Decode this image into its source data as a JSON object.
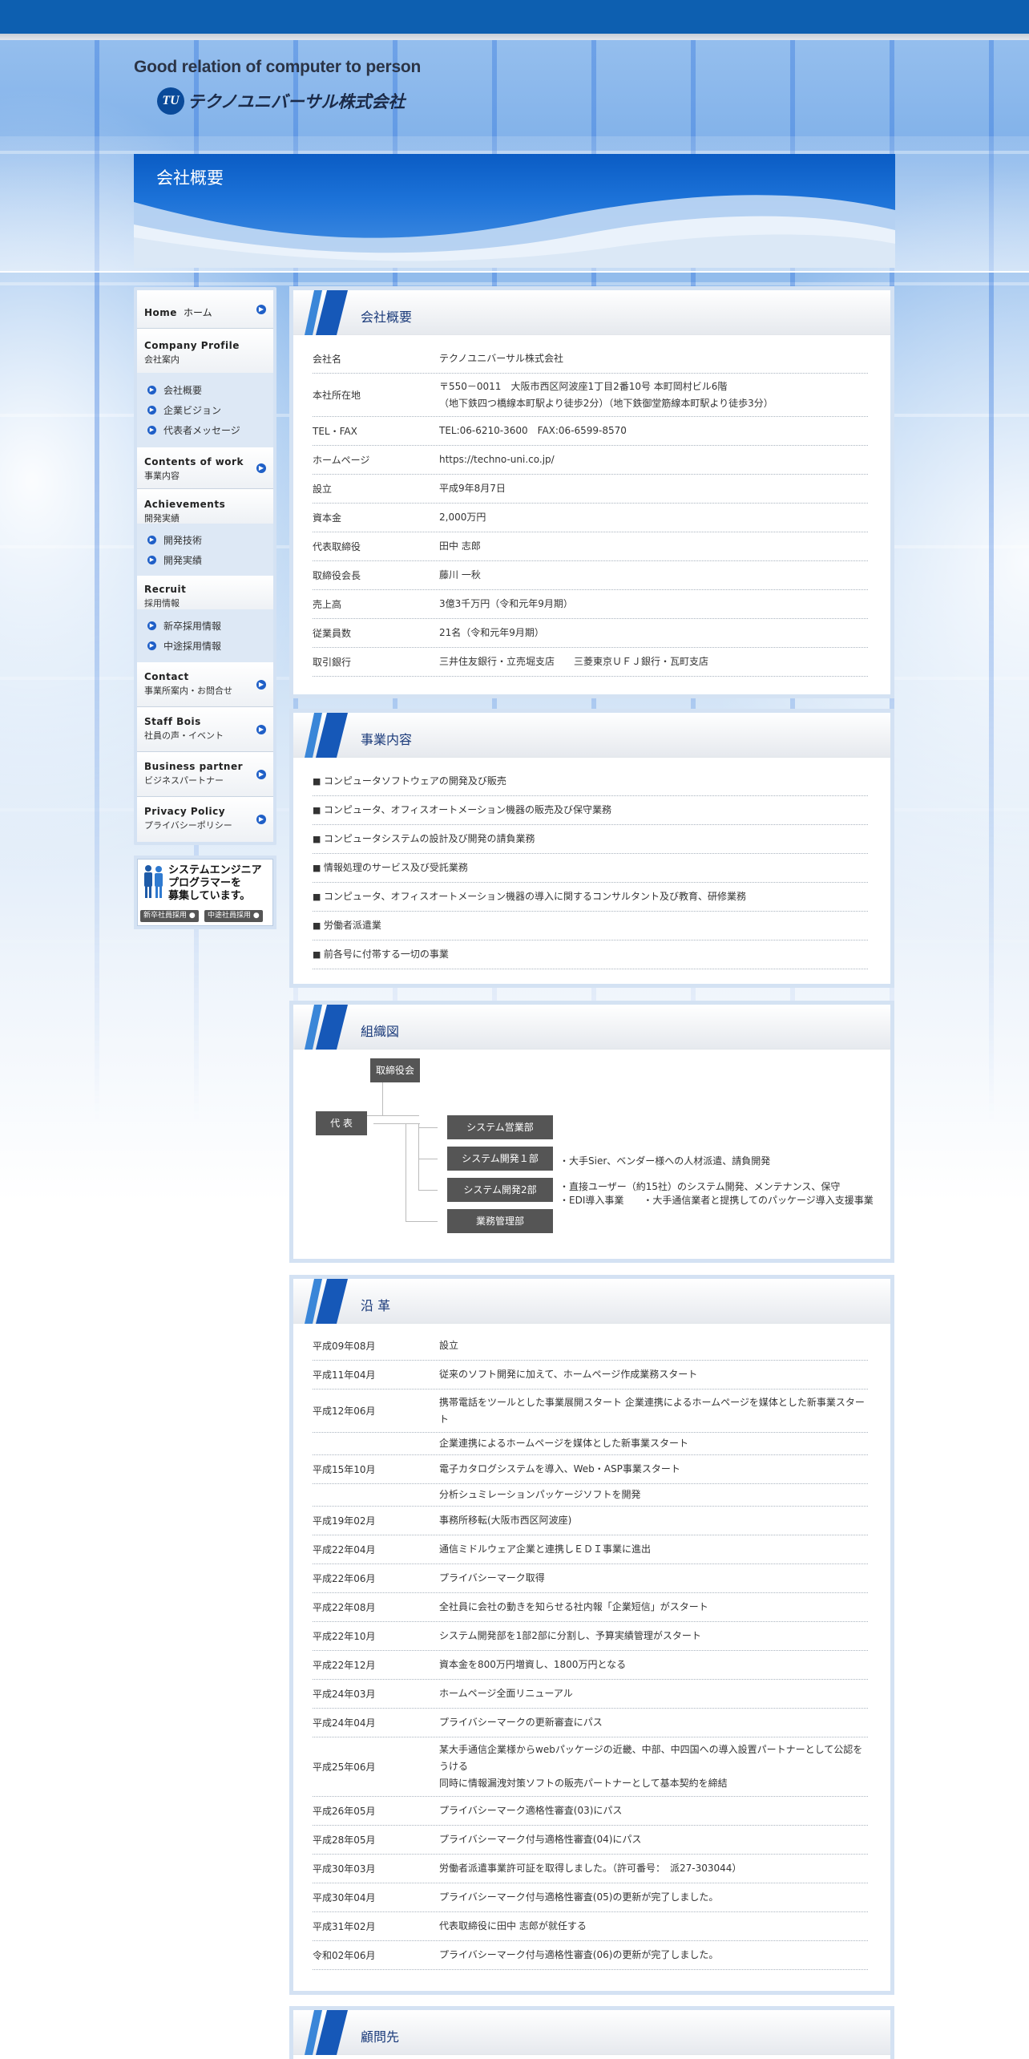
{
  "header": {
    "tagline": "Good relation of computer to person",
    "logo_mark": "TU",
    "logo_text": "テクノユニバーサル株式会社",
    "banner_title": "会社概要"
  },
  "sidebar": {
    "home": {
      "en": "Home",
      "ja": "ホーム"
    },
    "company": {
      "en": "Company Profile",
      "ja": "会社案内",
      "subs": [
        "会社概要",
        "企業ビジョン",
        "代表者メッセージ"
      ]
    },
    "work": {
      "en": "Contents of work",
      "ja": "事業内容"
    },
    "achievements": {
      "en": "Achievements",
      "ja": "開発実績",
      "subs": [
        "開発技術",
        "開発実績"
      ]
    },
    "recruit": {
      "en": "Recruit",
      "ja": "採用情報",
      "subs": [
        "新卒採用情報",
        "中途採用情報"
      ]
    },
    "contact": {
      "en": "Contact",
      "ja": "事業所案内・お問合せ"
    },
    "staff": {
      "en": "Staff Bois",
      "ja": "社員の声・イベント"
    },
    "partner": {
      "en": "Business partner",
      "ja": "ビジネスパートナー"
    },
    "privacy": {
      "en": "Privacy Policy",
      "ja": "プライバシーポリシー"
    },
    "recruit_banner": {
      "line1": "システムエンジニア",
      "line2": "プログラマーを",
      "line3": "募集しています。",
      "btn1": "新卒社員採用",
      "btn2": "中途社員採用"
    }
  },
  "profile": {
    "title": "会社概要",
    "rows": [
      {
        "k": "会社名",
        "v": "テクノユニバーサル株式会社"
      },
      {
        "k": "本社所在地",
        "v": "〒550－0011　大阪市西区阿波座1丁目2番10号 本町岡村ビル6階",
        "v2": "（地下鉄四つ橋線本町駅より徒歩2分）（地下鉄御堂筋線本町駅より徒歩3分）"
      },
      {
        "k": "TEL・FAX",
        "v": "TEL:06-6210-3600　FAX:06-6599-8570"
      },
      {
        "k": "ホームページ",
        "v": "https://techno-uni.co.jp/"
      },
      {
        "k": "設立",
        "v": "平成9年8月7日"
      },
      {
        "k": "資本金",
        "v": "2,000万円"
      },
      {
        "k": "代表取締役",
        "v": "田中 志郎"
      },
      {
        "k": "取締役会長",
        "v": "藤川 一秋"
      },
      {
        "k": "売上高",
        "v": "3億3千万円（令和元年9月期）"
      },
      {
        "k": "従業員数",
        "v": "21名（令和元年9月期）"
      },
      {
        "k": "取引銀行",
        "v": "三井住友銀行・立売堀支店　　三菱東京ＵＦＪ銀行・瓦町支店"
      }
    ]
  },
  "business": {
    "title": "事業内容",
    "items": [
      "コンピュータソフトウェアの開発及び販売",
      "コンピュータ、オフィスオートメーション機器の販売及び保守業務",
      "コンピュータシステムの設計及び開発の請負業務",
      "情報処理のサービス及び受託業務",
      "コンピュータ、オフィスオートメーション機器の導入に関するコンサルタント及び教育、研修業務",
      "労働者派遣業",
      "前各号に付帯する一切の事業"
    ]
  },
  "org": {
    "title": "組織図",
    "board": "取締役会",
    "ceo": "代 表",
    "depts": [
      "システム営業部",
      "システム開発１部",
      "システム開発2部",
      "業務管理部"
    ],
    "desc1": "・大手Sier、ベンダー様への人材派遣、請負開発",
    "desc2a": "・直接ユーザー（約15社）のシステム開発、メンテナンス、保守",
    "desc2b": "・EDI導入事業　　・大手通信業者と提携してのパッケージ導入支援事業"
  },
  "history": {
    "title": "沿 革",
    "rows": [
      {
        "k": "平成09年08月",
        "v": "設立"
      },
      {
        "k": "平成11年04月",
        "v": "従来のソフト開発に加えて、ホームページ作成業務スタート"
      },
      {
        "k": "平成12年06月",
        "v": "携帯電話をツールとした事業展開スタート 企業連携によるホームページを媒体とした新事業スタート"
      },
      {
        "k": "",
        "v": "企業連携によるホームページを媒体とした新事業スタート"
      },
      {
        "k": "平成15年10月",
        "v": "電子カタログシステムを導入、Web・ASP事業スタート"
      },
      {
        "k": "",
        "v": "分析シュミレーションパッケージソフトを開発"
      },
      {
        "k": "平成19年02月",
        "v": "事務所移転(大阪市西区阿波座)"
      },
      {
        "k": "平成22年04月",
        "v": "通信ミドルウェア企業と連携しＥＤＩ事業に進出"
      },
      {
        "k": "平成22年06月",
        "v": "プライバシーマーク取得"
      },
      {
        "k": "平成22年08月",
        "v": "全社員に会社の動きを知らせる社内報「企業短信」がスタート"
      },
      {
        "k": "平成22年10月",
        "v": "システム開発部を1部2部に分割し、予算実績管理がスタート"
      },
      {
        "k": "平成22年12月",
        "v": "資本金を800万円増資し、1800万円となる"
      },
      {
        "k": "平成24年03月",
        "v": "ホームページ全面リニューアル"
      },
      {
        "k": "平成24年04月",
        "v": "プライバシーマークの更新審査にパス"
      },
      {
        "k": "平成25年06月",
        "v": "某大手通信企業様からwebパッケージの近畿、中部、中四国への導入設置パートナーとして公認をうける",
        "v2": "同時に情報漏洩対策ソフトの販売パートナーとして基本契約を締結"
      },
      {
        "k": "平成26年05月",
        "v": "プライバシーマーク適格性審査(03)にパス"
      },
      {
        "k": "平成28年05月",
        "v": "プライバシーマーク付与適格性審査(04)にパス"
      },
      {
        "k": "平成30年03月",
        "v": "労働者派遣事業許可証を取得しました。（許可番号：　派27-303044）"
      },
      {
        "k": "平成30年04月",
        "v": "プライバシーマーク付与適格性審査(05)の更新が完了しました。"
      },
      {
        "k": "平成31年02月",
        "v": "代表取締役に田中 志郎が就任する"
      },
      {
        "k": "令和02年06月",
        "v": "プライバシーマーク付与適格性審査(06)の更新が完了しました。"
      }
    ]
  },
  "clients": {
    "title": "顧問先"
  }
}
